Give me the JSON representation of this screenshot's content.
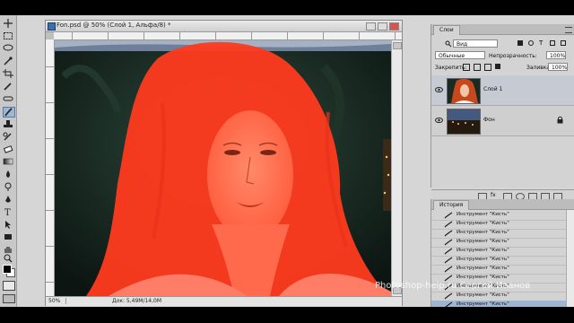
{
  "document": {
    "title": "Fon.psd @ 50% (Слой 1, Альфа/8) *",
    "zoom": "50%",
    "info": "Док: 5,49M/14,0M"
  },
  "layers_panel": {
    "tab": "Слои",
    "filter_kind": "Вид",
    "blend_mode": "Обычные",
    "opacity_label": "Непрозрачность:",
    "opacity_value": "100%",
    "lock_label": "Закрепить:",
    "fill_label": "Заливка:",
    "fill_value": "100%",
    "layers": [
      {
        "name": "Слой 1",
        "visible": true
      },
      {
        "name": "Фон",
        "visible": true,
        "locked": true
      }
    ]
  },
  "history_panel": {
    "tab": "История",
    "items": [
      "Инструмент \"Кисть\"",
      "Инструмент \"Кисть\"",
      "Инструмент \"Кисть\"",
      "Инструмент \"Кисть\"",
      "Инструмент \"Кисть\"",
      "Инструмент \"Кисть\"",
      "Инструмент \"Кисть\"",
      "Инструмент \"Кисть\"",
      "Инструмент \"Кисть\"",
      "Инструмент \"Кисть\"",
      "Инструмент \"Кисть\""
    ]
  },
  "overlay": {
    "watermark": "Photoshop-help.ru Сергей Иванов"
  },
  "colors": {
    "quick_mask_overlay": "#ff3b1f",
    "foreground": "#000000",
    "background": "#ffffff"
  },
  "icons": [
    "eye-icon",
    "lock-icon",
    "brush-icon",
    "trash-icon",
    "new-layer-icon",
    "link-icon",
    "fx-icon",
    "mask-icon",
    "folder-icon"
  ]
}
